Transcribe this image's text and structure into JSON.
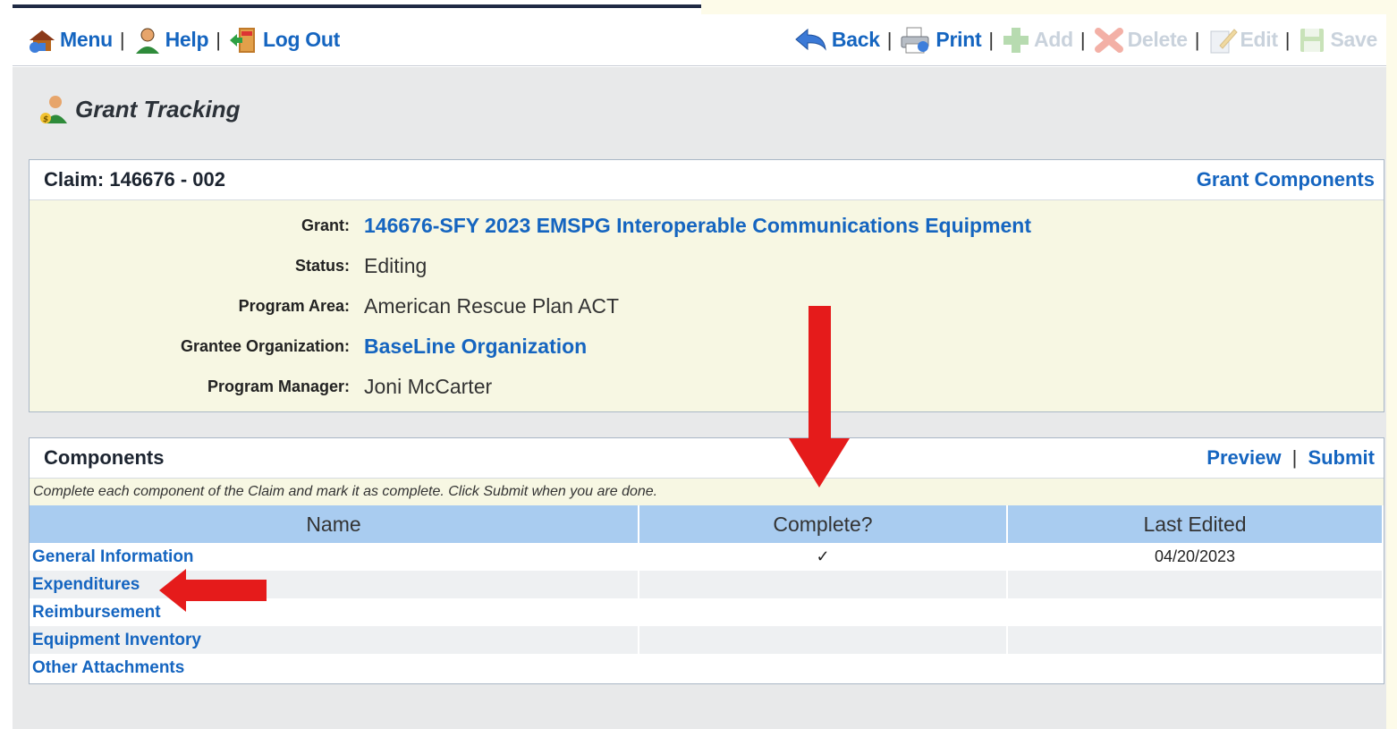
{
  "toolbar": {
    "left": [
      {
        "label": "Menu",
        "icon": "home-icon"
      },
      {
        "label": "Help",
        "icon": "help-person-icon"
      },
      {
        "label": "Log Out",
        "icon": "exit-door-icon"
      }
    ],
    "right": [
      {
        "label": "Back",
        "icon": "back-arrow-icon",
        "enabled": true
      },
      {
        "label": "Print",
        "icon": "printer-icon",
        "enabled": true
      },
      {
        "label": "Add",
        "icon": "add-icon",
        "enabled": false
      },
      {
        "label": "Delete",
        "icon": "delete-icon",
        "enabled": false
      },
      {
        "label": "Edit",
        "icon": "edit-icon",
        "enabled": false
      },
      {
        "label": "Save",
        "icon": "save-icon",
        "enabled": false
      }
    ]
  },
  "page": {
    "title": "Grant Tracking"
  },
  "claim": {
    "title": "Claim: 146676 - 002",
    "link": "Grant Components",
    "fields": [
      {
        "label": "Grant:",
        "value": "146676-SFY 2023 EMSPG Interoperable Communications Equipment",
        "link": true
      },
      {
        "label": "Status:",
        "value": "Editing",
        "link": false
      },
      {
        "label": "Program Area:",
        "value": "American Rescue Plan ACT",
        "link": false
      },
      {
        "label": "Grantee Organization:",
        "value": "BaseLine Organization",
        "link": true
      },
      {
        "label": "Program Manager:",
        "value": "Joni McCarter",
        "link": false
      }
    ]
  },
  "components": {
    "title": "Components",
    "preview_label": "Preview",
    "submit_label": "Submit",
    "divider": "|",
    "note": "Complete each component of the Claim and mark it as complete. Click Submit when you are done.",
    "columns": [
      "Name",
      "Complete?",
      "Last Edited"
    ],
    "rows": [
      {
        "name": "General Information",
        "complete": "✓",
        "last_edited": "04/20/2023"
      },
      {
        "name": "Expenditures",
        "complete": "",
        "last_edited": ""
      },
      {
        "name": "Reimbursement",
        "complete": "",
        "last_edited": ""
      },
      {
        "name": "Equipment Inventory",
        "complete": "",
        "last_edited": ""
      },
      {
        "name": "Other Attachments",
        "complete": "",
        "last_edited": ""
      }
    ]
  },
  "colors": {
    "link": "#1565c0",
    "header": "#a9ccf0",
    "panel": "#f7f7e3",
    "annotation_arrow": "#e51b1b"
  }
}
